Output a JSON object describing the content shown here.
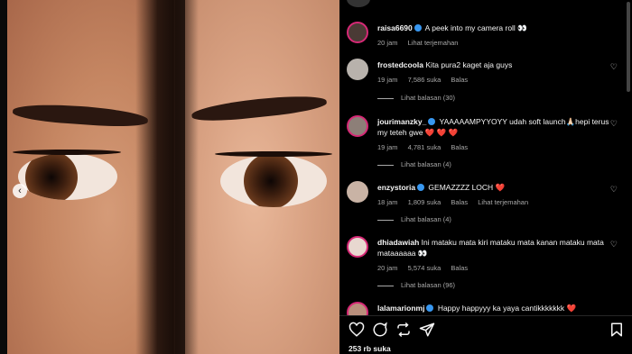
{
  "post": {
    "author": "raisa6690",
    "caption": "A peek into my camera roll 👀",
    "time": "20 jam",
    "translate": "Lihat terjemahan"
  },
  "comments": [
    {
      "user": "frostedcoola",
      "verified": false,
      "text": "Kita pura2 kaget aja guys",
      "time": "19 jam",
      "likes": "7,586 suka",
      "reply": "Balas",
      "replies": "Lihat balasan (30)"
    },
    {
      "user": "jourimanzky_",
      "verified": true,
      "text": "YAAAAAMPYYOYY udah soft launch🙏🏻hepi terus my teteh gwe ❤️ ❤️ ❤️",
      "time": "19 jam",
      "likes": "4,781 suka",
      "reply": "Balas",
      "replies": "Lihat balasan (4)"
    },
    {
      "user": "enzystoria",
      "verified": true,
      "text": "GEMAZZZZ LOCH ❤️",
      "time": "18 jam",
      "likes": "1,809 suka",
      "reply": "Balas",
      "translate": "Lihat terjemahan",
      "replies": "Lihat balasan (4)"
    },
    {
      "user": "dhiadawiah",
      "verified": false,
      "text": "Ini mataku mata kiri mataku mata kanan mataku mata mataaaaaa 👀",
      "time": "20 jam",
      "likes": "5,574 suka",
      "reply": "Balas",
      "replies": "Lihat balasan (96)"
    },
    {
      "user": "lalamarionmj",
      "verified": true,
      "text": "Happy happyyy ka yaya cantikkkkkkk ❤️"
    }
  ],
  "actions": {
    "like_icon": "heart-icon",
    "comment_icon": "comment-icon",
    "share_icon": "repost-icon",
    "send_icon": "send-icon",
    "save_icon": "bookmark-icon",
    "likes_count": "253 rb suka"
  },
  "colors": {
    "background": "#000000",
    "text": "#f5f5f5",
    "muted": "#a8a8a8",
    "verified": "#3897f0",
    "heart_red": "#ff3040"
  }
}
